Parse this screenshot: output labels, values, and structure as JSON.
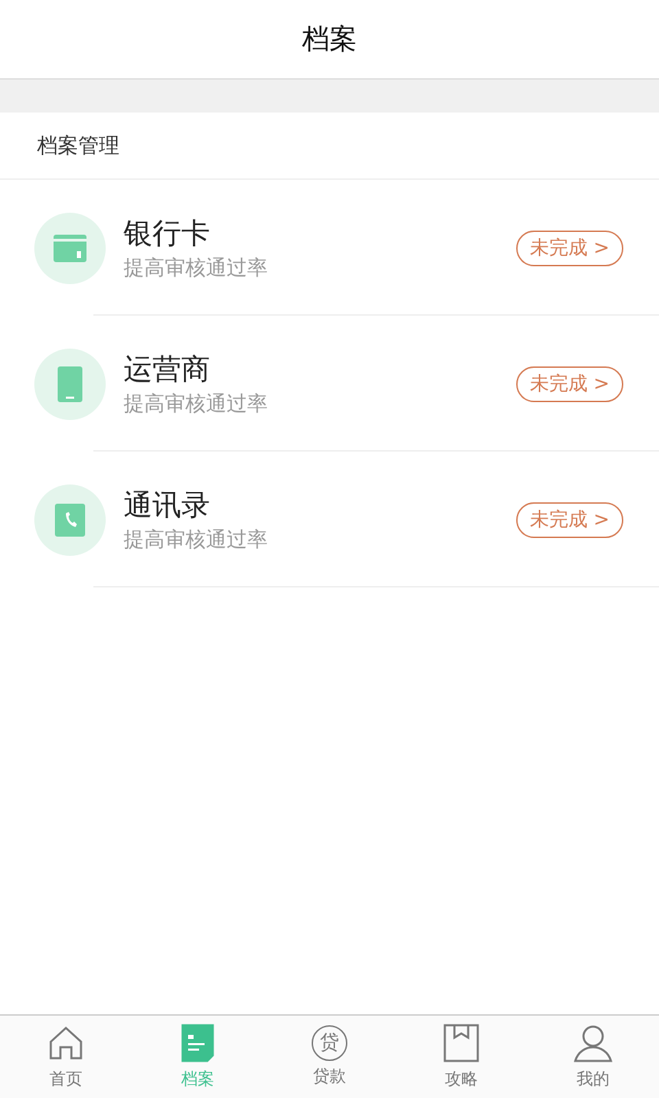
{
  "header": {
    "title": "档案"
  },
  "section": {
    "title": "档案管理"
  },
  "items": [
    {
      "kind": "card",
      "title": "银行卡",
      "subtitle": "提高审核通过率",
      "status": "未完成 >"
    },
    {
      "kind": "phone",
      "title": "运营商",
      "subtitle": "提高审核通过率",
      "status": "未完成 >"
    },
    {
      "kind": "contacts",
      "title": "通讯录",
      "subtitle": "提高审核通过率",
      "status": "未完成 >"
    }
  ],
  "tabs": [
    {
      "kind": "home",
      "label": "首页",
      "selected": false
    },
    {
      "kind": "file",
      "label": "档案",
      "selected": true
    },
    {
      "kind": "loan",
      "label": "贷款",
      "icon_text": "贷",
      "selected": false
    },
    {
      "kind": "guide",
      "label": "攻略",
      "selected": false
    },
    {
      "kind": "user",
      "label": "我的",
      "selected": false
    }
  ]
}
